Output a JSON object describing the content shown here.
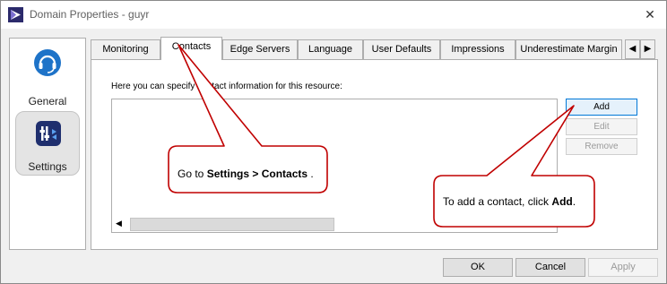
{
  "window": {
    "title": "Domain Properties - guyr",
    "close_glyph": "✕"
  },
  "nav": {
    "items": [
      {
        "label": "General",
        "icon": "headset-icon"
      },
      {
        "label": "Settings",
        "icon": "settings-icon"
      }
    ]
  },
  "tabs": {
    "items": [
      "Monitoring",
      "Contacts",
      "Edge Servers",
      "Language",
      "User Defaults",
      "Impressions",
      "Underestimate Margin"
    ],
    "active": "Contacts",
    "scroll_left": "◀",
    "scroll_right": "▶"
  },
  "contacts": {
    "instruction": "Here you can specify contact information for this resource:",
    "buttons": {
      "add": "Add",
      "edit": "Edit",
      "remove": "Remove"
    },
    "hscroll_left": "◀"
  },
  "footer": {
    "ok": "OK",
    "cancel": "Cancel",
    "apply": "Apply"
  },
  "callouts": {
    "settings": {
      "prefix": "Go to ",
      "bold": "Settings > Contacts",
      "suffix": "."
    },
    "add": {
      "prefix": "To add a contact, click ",
      "bold": "Add",
      "suffix": "."
    }
  },
  "colors": {
    "callout_border": "#c00000",
    "accent": "#0078d7",
    "nav_icon_general": "#1e73c8",
    "nav_icon_settings": "#1f2f6e"
  }
}
